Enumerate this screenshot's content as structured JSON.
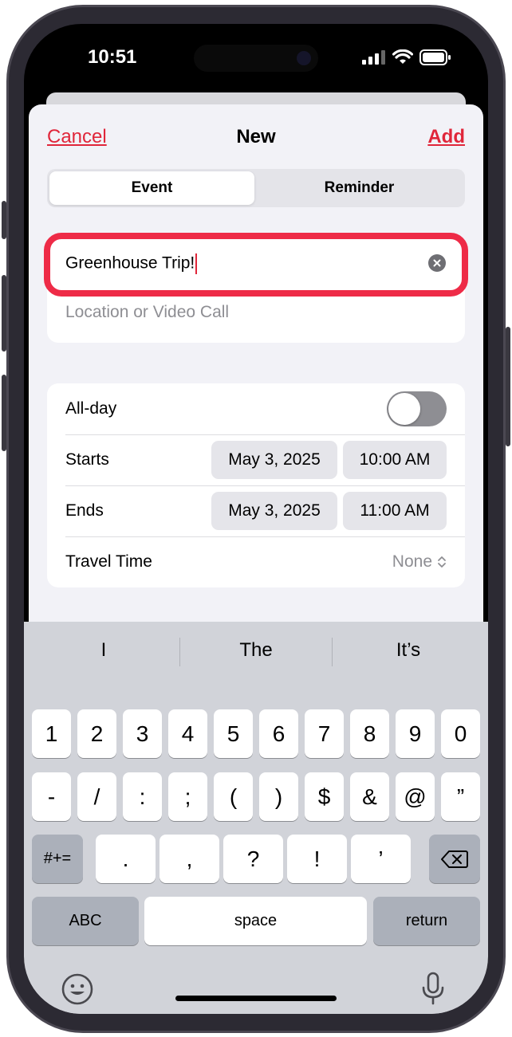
{
  "status": {
    "time": "10:51",
    "icons": [
      "signal-icon",
      "wifi-icon",
      "battery-icon"
    ]
  },
  "nav": {
    "cancel": "Cancel",
    "title": "New",
    "add": "Add"
  },
  "segments": {
    "event": "Event",
    "reminder": "Reminder",
    "selected": "Event"
  },
  "event": {
    "title_value": "Greenhouse Trip!",
    "location_placeholder": "Location or Video Call"
  },
  "details": {
    "allday_label": "All-day",
    "allday_on": false,
    "starts_label": "Starts",
    "starts_date": "May 3, 2025",
    "starts_time": "10:00 AM",
    "ends_label": "Ends",
    "ends_date": "May 3, 2025",
    "ends_time": "11:00 AM",
    "travel_label": "Travel Time",
    "travel_value": "None"
  },
  "keyboard": {
    "suggestions": [
      "I",
      "The",
      "It’s"
    ],
    "row1": [
      "1",
      "2",
      "3",
      "4",
      "5",
      "6",
      "7",
      "8",
      "9",
      "0"
    ],
    "row2": [
      "-",
      "/",
      ":",
      ";",
      "(",
      ")",
      "$",
      "&",
      "@",
      "”"
    ],
    "symbols_key": "#+=",
    "row3": [
      ".",
      ",",
      "?",
      "!",
      "’"
    ],
    "abc_key": "ABC",
    "space_key": "space",
    "return_key": "return"
  },
  "colors": {
    "accent": "#e0263a",
    "highlight": "#ee2b47",
    "sheet": "#f2f2f7",
    "keyboard": "#d1d3d9"
  }
}
